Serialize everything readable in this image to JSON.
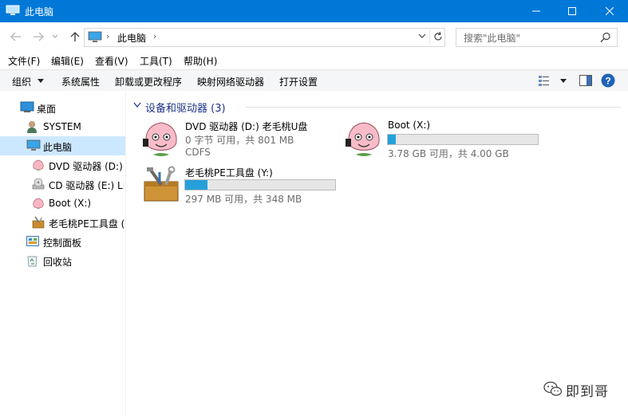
{
  "window": {
    "title": "此电脑",
    "accent_color": "#0078d7"
  },
  "address": {
    "crumb": "此电脑",
    "search_placeholder": "搜索\"此电脑\""
  },
  "menu": [
    "文件(F)",
    "编辑(E)",
    "查看(V)",
    "工具(T)",
    "帮助(H)"
  ],
  "commands": [
    "组织",
    "系统属性",
    "卸载或更改程序",
    "映射网络驱动器",
    "打开设置"
  ],
  "nav": [
    {
      "label": "桌面",
      "icon": "desktop-icon"
    },
    {
      "label": "SYSTEM",
      "icon": "user-icon"
    },
    {
      "label": "此电脑",
      "icon": "computer-icon",
      "selected": true
    },
    {
      "label": "DVD 驱动器 (D:) 老毛桃U盘",
      "icon": "peach-icon"
    },
    {
      "label": "CD 驱动器 (E:) LMT",
      "icon": "cd-drive-icon"
    },
    {
      "label": "Boot (X:)",
      "icon": "peach-icon"
    },
    {
      "label": "老毛桃PE工具盘 (Y:)",
      "icon": "toolbox-icon"
    },
    {
      "label": "控制面板",
      "icon": "control-panel-icon"
    },
    {
      "label": "回收站",
      "icon": "recycle-bin-icon"
    }
  ],
  "group": {
    "title": "设备和驱动器 (3)"
  },
  "drives": [
    {
      "name": "DVD 驱动器 (D:) 老毛桃U盘",
      "line1": "0 字节 可用，共 801 MB",
      "line2": "CDFS",
      "icon": "peach-icon"
    },
    {
      "name": "Boot (X:)",
      "detail": "3.78 GB 可用，共 4.00 GB",
      "used_fraction": 0.055,
      "icon": "peach-icon"
    },
    {
      "name": "老毛桃PE工具盘 (Y:)",
      "detail": "297 MB 可用，共 348 MB",
      "used_fraction": 0.147,
      "icon": "toolbox-icon"
    }
  ],
  "watermark": {
    "text": "即到哥",
    "icon": "wechat-icon"
  }
}
